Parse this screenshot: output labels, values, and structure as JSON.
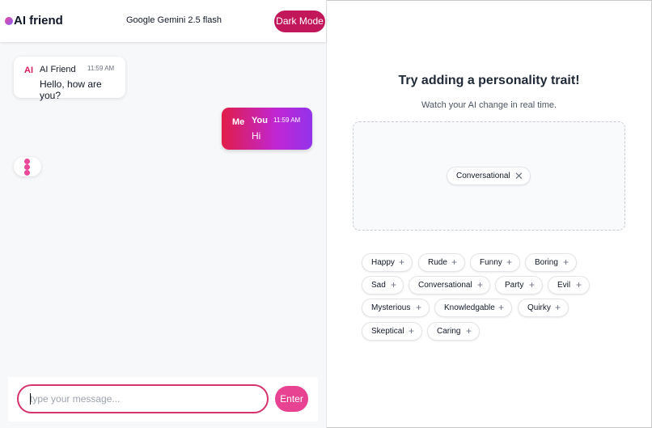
{
  "header": {
    "brand": "AI friend",
    "model": "Google Gemini 2.5 flash",
    "dark_mode_label": "Dark Mode"
  },
  "messages": {
    "ai": {
      "avatar": "AI",
      "name": "AI Friend",
      "time": "11:59 AM",
      "text": "Hello, how are you?"
    },
    "me": {
      "avatar": "Me",
      "name": "You",
      "time": "11:59 AM",
      "text": "Hi"
    }
  },
  "composer": {
    "placeholder": "type your message...",
    "enter_label": "Enter"
  },
  "traits_panel": {
    "title": "Try adding a personality trait!",
    "subtitle": "Watch your AI change in real time.",
    "active": [
      {
        "label": "Conversational",
        "icon": "close-icon"
      }
    ],
    "available": [
      {
        "label": "Happy",
        "icon": "plus-icon"
      },
      {
        "label": "Rude",
        "icon": "plus-icon"
      },
      {
        "label": "Funny",
        "icon": "plus-icon"
      },
      {
        "label": "Boring",
        "icon": "plus-icon"
      },
      {
        "label": "Sad",
        "icon": "plus-icon"
      },
      {
        "label": "Conversational",
        "icon": "plus-icon"
      },
      {
        "label": "Party",
        "icon": "plus-icon"
      },
      {
        "label": "Evil",
        "icon": "plus-icon"
      },
      {
        "label": "Mysterious",
        "icon": "plus-icon"
      },
      {
        "label": "Knowledgable",
        "icon": "plus-icon"
      },
      {
        "label": "Quirky",
        "icon": "plus-icon"
      },
      {
        "label": "Skeptical",
        "icon": "plus-icon"
      },
      {
        "label": "Caring",
        "icon": "plus-icon"
      }
    ]
  },
  "colors": {
    "accent": "#c2185b",
    "gradient_start": "#e11d48",
    "gradient_end": "#9333ea",
    "typing_dots": "#ec4899"
  }
}
